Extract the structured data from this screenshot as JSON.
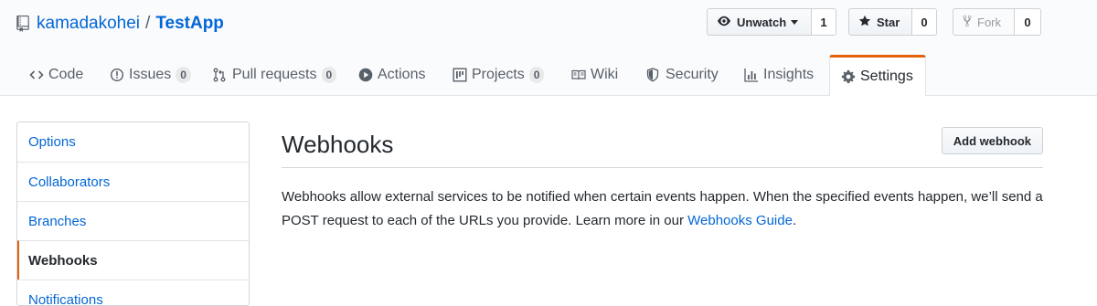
{
  "repo": {
    "owner": "kamadakohei",
    "separator": "/",
    "name": "TestApp"
  },
  "actions": [
    {
      "label": "Unwatch",
      "count": "1",
      "icon": "eye-icon",
      "dropdown": true
    },
    {
      "label": "Star",
      "count": "0",
      "icon": "star-icon"
    },
    {
      "label": "Fork",
      "count": "0",
      "icon": "fork-icon",
      "disabled": true
    }
  ],
  "tabs": [
    {
      "label": "Code",
      "icon": "code-icon"
    },
    {
      "label": "Issues",
      "icon": "issue-icon",
      "count": "0"
    },
    {
      "label": "Pull requests",
      "icon": "pull-request-icon",
      "count": "0"
    },
    {
      "label": "Actions",
      "icon": "play-icon"
    },
    {
      "label": "Projects",
      "icon": "project-icon",
      "count": "0"
    },
    {
      "label": "Wiki",
      "icon": "book-icon"
    },
    {
      "label": "Security",
      "icon": "shield-icon"
    },
    {
      "label": "Insights",
      "icon": "graph-icon"
    },
    {
      "label": "Settings",
      "icon": "gear-icon",
      "selected": true
    }
  ],
  "menu": [
    {
      "label": "Options"
    },
    {
      "label": "Collaborators"
    },
    {
      "label": "Branches"
    },
    {
      "label": "Webhooks",
      "selected": true
    },
    {
      "label": "Notifications"
    }
  ],
  "main": {
    "title": "Webhooks",
    "add_button": "Add webhook",
    "description": "Webhooks allow external services to be notified when certain events happen. When the specified events happen, we’ll send a POST request to each of the URLs you provide. Learn more in our",
    "link_text": "Webhooks Guide",
    "trailing": "."
  },
  "colors": {
    "accent": "#e36209",
    "link": "#0366d6",
    "text": "#24292e",
    "muted": "#586069"
  }
}
